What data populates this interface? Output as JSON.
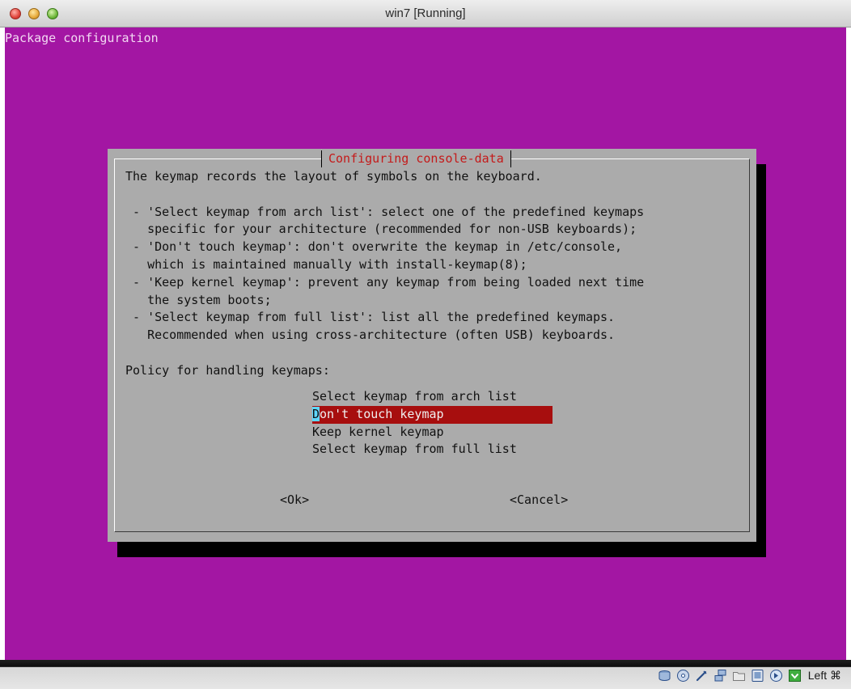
{
  "window": {
    "title": "win7 [Running]"
  },
  "console": {
    "header": "Package configuration",
    "background": "#a316a3",
    "dialog": {
      "title": "Configuring console-data",
      "text": "The keymap records the layout of symbols on the keyboard.\n\n - 'Select keymap from arch list': select one of the predefined keymaps\n   specific for your architecture (recommended for non-USB keyboards);\n - 'Don't touch keymap': don't overwrite the keymap in /etc/console,\n   which is maintained manually with install-keymap(8);\n - 'Keep kernel keymap': prevent any keymap from being loaded next time\n   the system boots;\n - 'Select keymap from full list': list all the predefined keymaps.\n   Recommended when using cross-architecture (often USB) keyboards.\n\nPolicy for handling keymaps:",
      "options": [
        "Select keymap from arch list",
        "Don't touch keymap",
        "Keep kernel keymap",
        "Select keymap from full list"
      ],
      "selected_cursor_char": "D",
      "selected_rest": "on't touch keymap",
      "ok_label": "<Ok>",
      "cancel_label": "<Cancel>",
      "highlight_color": "#a70e0e"
    }
  },
  "statusbar": {
    "host_key": "Left ⌘",
    "icons": [
      "hard-disk-icon",
      "optical-drive-icon",
      "usb-icon",
      "network-icon",
      "shared-folder-icon",
      "display-icon",
      "mouse-integration-icon",
      "capture-icon"
    ]
  }
}
